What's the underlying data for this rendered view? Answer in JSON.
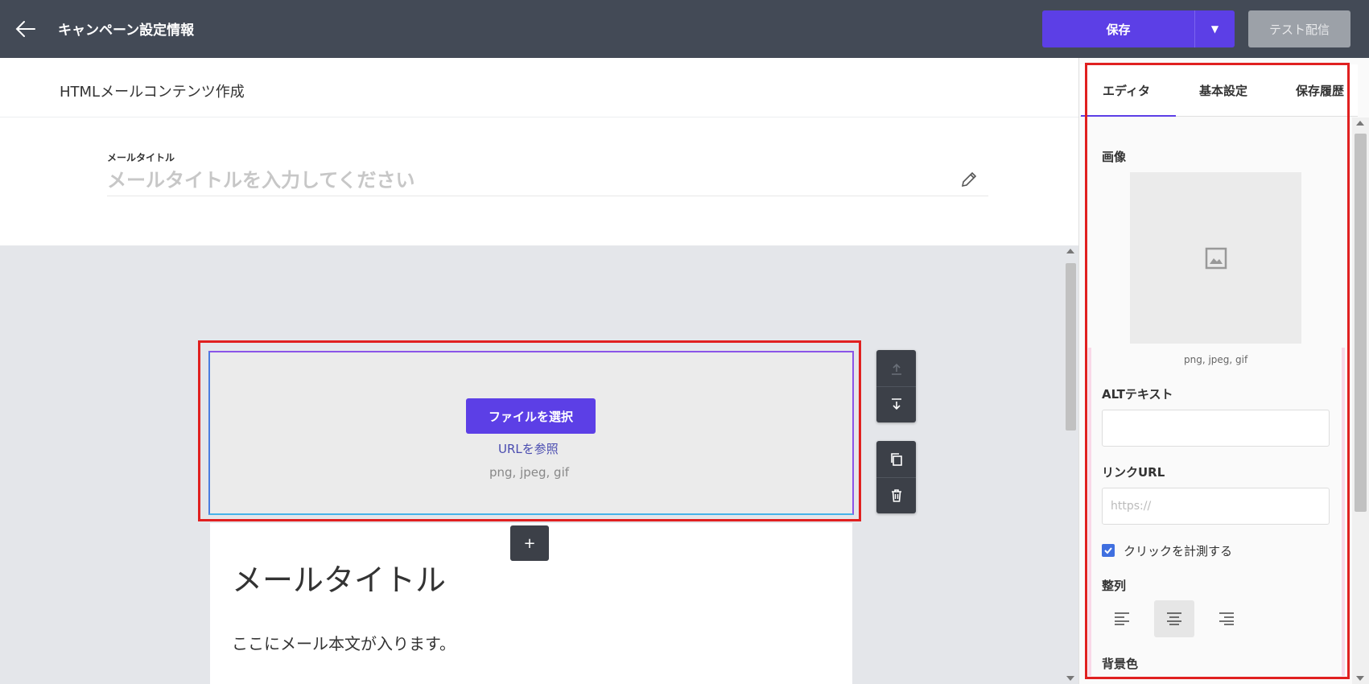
{
  "header": {
    "title": "キャンペーン設定情報",
    "save_label": "保存",
    "test_label": "テスト配信"
  },
  "subheader": {
    "title": "HTMLメールコンテンツ作成"
  },
  "mail_title": {
    "label": "メールタイトル",
    "placeholder": "メールタイトルを入力してください"
  },
  "image_block": {
    "file_button": "ファイルを選択",
    "url_link": "URLを参照",
    "file_types": "png, jpeg, gif"
  },
  "mail_content": {
    "heading": "メールタイトル",
    "body": "ここにメール本文が入ります。",
    "add_label": "+"
  },
  "panel": {
    "tabs": [
      {
        "label": "エディタ"
      },
      {
        "label": "基本設定"
      },
      {
        "label": "保存履歴"
      }
    ],
    "image_label": "画像",
    "image_types": "png, jpeg, gif",
    "alt_label": "ALTテキスト",
    "alt_value": "",
    "link_label": "リンクURL",
    "link_placeholder": "https://",
    "track_label": "クリックを計測する",
    "track_checked": true,
    "align_label": "整列",
    "align_selected": "center",
    "bg_label": "背景色"
  },
  "colors": {
    "header_bg": "#434a56",
    "accent": "#5c3fe6",
    "highlight": "#e02020"
  }
}
